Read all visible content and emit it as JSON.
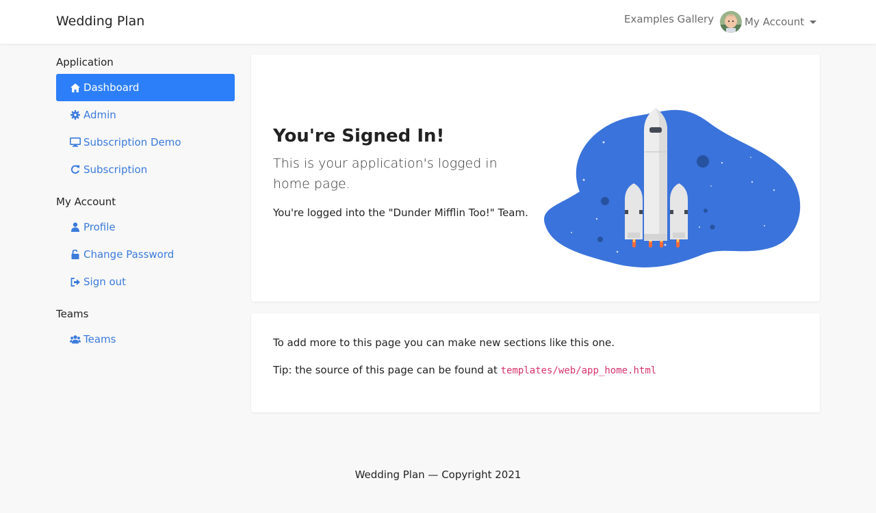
{
  "navbar": {
    "brand": "Wedding Plan",
    "gallery_link": "Examples Gallery",
    "account_label": "My Account"
  },
  "sidebar": {
    "sections": [
      {
        "heading": "Application",
        "items": [
          {
            "label": "Dashboard",
            "icon": "home-icon",
            "active": true
          },
          {
            "label": "Admin",
            "icon": "gear-icon",
            "active": false
          },
          {
            "label": "Subscription Demo",
            "icon": "desktop-icon",
            "active": false
          },
          {
            "label": "Subscription",
            "icon": "refresh-icon",
            "active": false
          }
        ]
      },
      {
        "heading": "My Account",
        "items": [
          {
            "label": "Profile",
            "icon": "user-icon",
            "active": false
          },
          {
            "label": "Change Password",
            "icon": "unlock-icon",
            "active": false
          },
          {
            "label": "Sign out",
            "icon": "sign-out-icon",
            "active": false
          }
        ]
      },
      {
        "heading": "Teams",
        "items": [
          {
            "label": "Teams",
            "icon": "users-icon",
            "active": false
          }
        ]
      }
    ]
  },
  "hero": {
    "title": "You're Signed In!",
    "subtitle": "This is your application's logged in home page.",
    "team_text": "You're logged into the \"Dunder Mifflin Too!\" Team."
  },
  "section": {
    "line1": "To add more to this page you can make new sections like this one.",
    "tip_prefix": "Tip: the source of this page can be found at",
    "tip_code": "templates/web/app_home.html"
  },
  "footer": {
    "text": "Wedding Plan — Copyright 2021"
  },
  "colors": {
    "accent": "#2d7ff9",
    "link": "#3b7bdc",
    "code": "#d6336c",
    "blob": "#3a73db"
  }
}
